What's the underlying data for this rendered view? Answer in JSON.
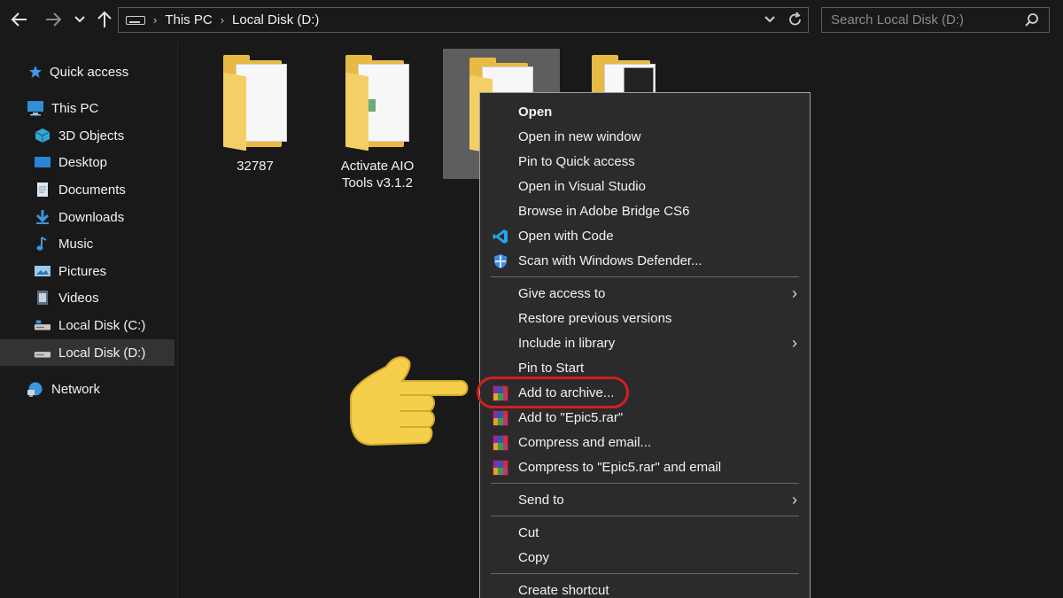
{
  "addressbar": {
    "crumbs": [
      "This PC",
      "Local Disk (D:)"
    ],
    "search_placeholder": "Search Local Disk (D:)"
  },
  "sidebar": {
    "quick_access": "Quick access",
    "this_pc": "This PC",
    "items": [
      "3D Objects",
      "Desktop",
      "Documents",
      "Downloads",
      "Music",
      "Pictures",
      "Videos",
      "Local Disk (C:)",
      "Local Disk (D:)"
    ],
    "network": "Network",
    "selected": "Local Disk (D:)"
  },
  "files": [
    {
      "name": "32787"
    },
    {
      "name": "Activate AIO Tools v3.1.2"
    }
  ],
  "context_menu": {
    "group1": [
      "Open",
      "Open in new window",
      "Pin to Quick access",
      "Open in Visual Studio",
      "Browse in Adobe Bridge CS6",
      "Open with Code",
      "Scan with Windows Defender..."
    ],
    "group2": [
      "Give access to",
      "Restore previous versions",
      "Include in library",
      "Pin to Start",
      "Add to archive...",
      "Add to \"Epic5.rar\"",
      "Compress and email...",
      "Compress to \"Epic5.rar\" and email"
    ],
    "group3": [
      "Send to"
    ],
    "group4": [
      "Cut",
      "Copy"
    ],
    "group5": [
      "Create shortcut"
    ],
    "highlighted": "Add to archive..."
  },
  "colors": {
    "background": "#191919",
    "menu_bg": "#2b2b2b",
    "highlight_ring": "#d21f1f",
    "folder": "#e8b945",
    "hand": "#f5cf4b"
  },
  "icons": [
    "back-arrow-icon",
    "forward-arrow-icon",
    "chevron-down-icon",
    "up-arrow-icon",
    "drive-icon",
    "refresh-icon",
    "search-icon",
    "star-icon",
    "monitor-icon",
    "cube-icon",
    "document-icon",
    "download-icon",
    "music-icon",
    "picture-icon",
    "video-icon",
    "network-icon",
    "vscode-icon",
    "shield-icon",
    "winrar-icon",
    "pointing-hand-icon"
  ]
}
